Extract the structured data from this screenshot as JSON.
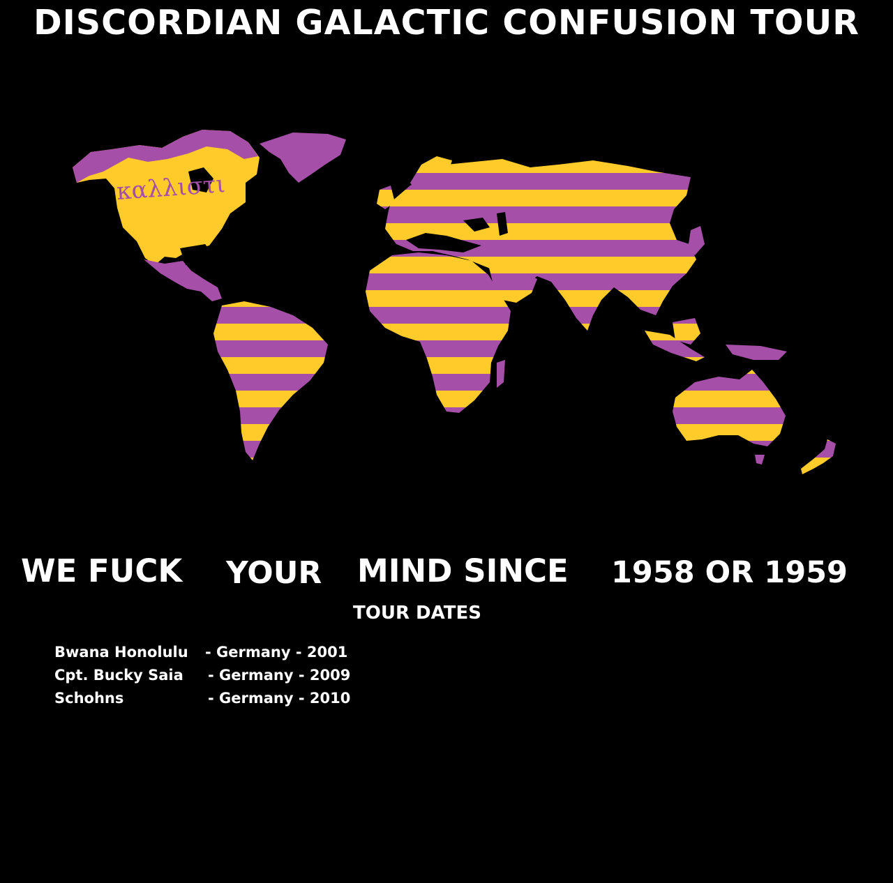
{
  "title": "DISCORDIAN GALACTIC CONFUSION TOUR",
  "map": {
    "inscription": "καλλιστι",
    "colors": {
      "purple": "#a64fa8",
      "yellow": "#ffcb2b",
      "background": "#000000"
    }
  },
  "slogan": {
    "words": [
      "WE FUCK",
      "YOUR",
      "MIND SINCE",
      "1958 OR 1959"
    ]
  },
  "tour": {
    "heading": "TOUR DATES",
    "entries": [
      {
        "who": "Bwana Honolulu",
        "rest": "- Germany - 2001"
      },
      {
        "who": "Cpt. Bucky Saia ",
        "rest": "- Germany - 2009"
      },
      {
        "who": "Schohns",
        "rest": "- Germany - 2010"
      }
    ]
  }
}
